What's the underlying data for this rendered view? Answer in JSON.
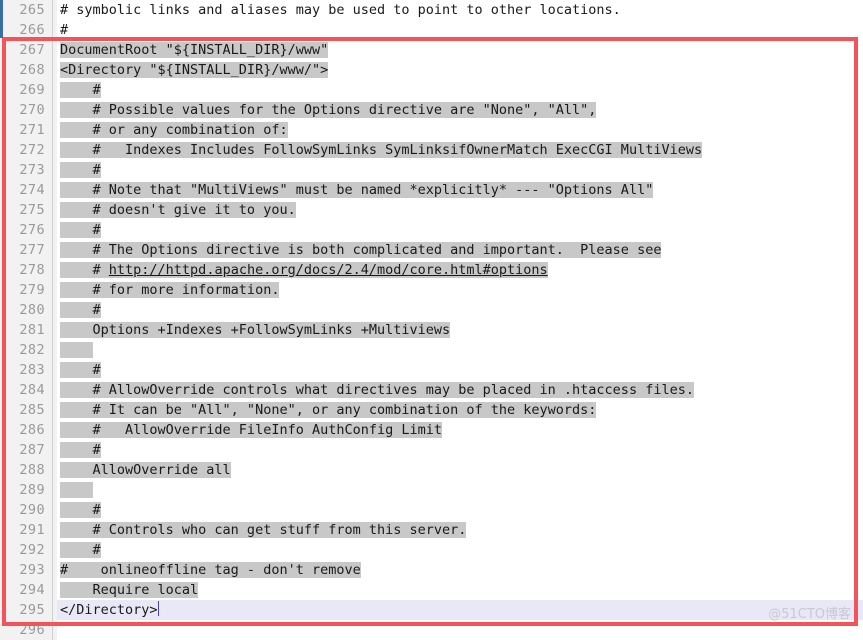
{
  "app": {
    "type": "code-editor",
    "language": "apache-config",
    "watermark": "@51CTO博客",
    "accent_red": "#f4535a",
    "selection_color": "#c8c8c8",
    "current_line_color": "#e8e8f6",
    "gutter_color": "#f2f2f2",
    "line_number_color": "#9a9a9a",
    "text_color": "#1a1a1a",
    "caret_color": "#4b3fbe"
  },
  "annotation": {
    "shape": "rectangle",
    "color": "#f4535a",
    "covers_lines": "267-295"
  },
  "lines": [
    {
      "num": "265",
      "text": "# symbolic links and aliases may be used to point to other locations.",
      "selected": false,
      "current": false
    },
    {
      "num": "266",
      "text": "#",
      "selected": false,
      "current": false
    },
    {
      "num": "267",
      "text": "DocumentRoot \"${INSTALL_DIR}/www\"",
      "selected": true,
      "current": false
    },
    {
      "num": "268",
      "text": "<Directory \"${INSTALL_DIR}/www/\">",
      "selected": true,
      "current": false
    },
    {
      "num": "269",
      "text": "    #",
      "selected": true,
      "current": false
    },
    {
      "num": "270",
      "text": "    # Possible values for the Options directive are \"None\", \"All\",",
      "selected": true,
      "current": false
    },
    {
      "num": "271",
      "text": "    # or any combination of:",
      "selected": true,
      "current": false
    },
    {
      "num": "272",
      "text": "    #   Indexes Includes FollowSymLinks SymLinksifOwnerMatch ExecCGI MultiViews",
      "selected": true,
      "current": false
    },
    {
      "num": "273",
      "text": "    #",
      "selected": true,
      "current": false
    },
    {
      "num": "274",
      "text": "    # Note that \"MultiViews\" must be named *explicitly* --- \"Options All\"",
      "selected": true,
      "current": false
    },
    {
      "num": "275",
      "text": "    # doesn't give it to you.",
      "selected": true,
      "current": false
    },
    {
      "num": "276",
      "text": "    #",
      "selected": true,
      "current": false
    },
    {
      "num": "277",
      "text": "    # The Options directive is both complicated and important.  Please see",
      "selected": true,
      "current": false
    },
    {
      "num": "278",
      "text": "    # http://httpd.apache.org/docs/2.4/mod/core.html#options",
      "selected": true,
      "current": false,
      "link_from": 6
    },
    {
      "num": "279",
      "text": "    # for more information.",
      "selected": true,
      "current": false
    },
    {
      "num": "280",
      "text": "    #",
      "selected": true,
      "current": false
    },
    {
      "num": "281",
      "text": "    Options +Indexes +FollowSymLinks +Multiviews",
      "selected": true,
      "current": false
    },
    {
      "num": "282",
      "text": "    ",
      "selected": true,
      "current": false
    },
    {
      "num": "283",
      "text": "    #",
      "selected": true,
      "current": false
    },
    {
      "num": "284",
      "text": "    # AllowOverride controls what directives may be placed in .htaccess files.",
      "selected": true,
      "current": false
    },
    {
      "num": "285",
      "text": "    # It can be \"All\", \"None\", or any combination of the keywords:",
      "selected": true,
      "current": false
    },
    {
      "num": "286",
      "text": "    #   AllowOverride FileInfo AuthConfig Limit",
      "selected": true,
      "current": false
    },
    {
      "num": "287",
      "text": "    #",
      "selected": true,
      "current": false
    },
    {
      "num": "288",
      "text": "    AllowOverride all",
      "selected": true,
      "current": false
    },
    {
      "num": "289",
      "text": "    ",
      "selected": true,
      "current": false
    },
    {
      "num": "290",
      "text": "    #",
      "selected": true,
      "current": false
    },
    {
      "num": "291",
      "text": "    # Controls who can get stuff from this server.",
      "selected": true,
      "current": false
    },
    {
      "num": "292",
      "text": "    #",
      "selected": true,
      "current": false
    },
    {
      "num": "293",
      "text": "#    onlineoffline tag - don't remove",
      "selected": true,
      "current": false
    },
    {
      "num": "294",
      "text": "    Require local",
      "selected": true,
      "current": false
    },
    {
      "num": "295",
      "text": "</Directory>",
      "selected": false,
      "current": true,
      "caret": true
    },
    {
      "num": "296",
      "text": "",
      "selected": false,
      "current": false
    }
  ]
}
